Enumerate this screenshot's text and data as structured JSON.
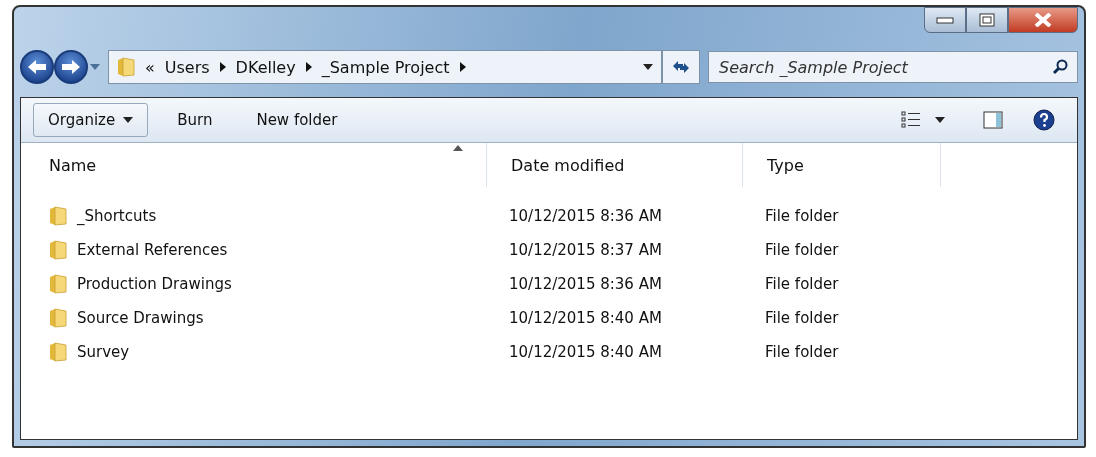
{
  "address_bar": {
    "overflow": "«",
    "crumbs": [
      "Users",
      "DKelley",
      "_Sample Project"
    ]
  },
  "search": {
    "placeholder": "Search _Sample Project"
  },
  "toolbar": {
    "buttons": [
      "Organize",
      "Burn",
      "New folder"
    ]
  },
  "table": {
    "columns": [
      "Name",
      "Date modified",
      "Type"
    ],
    "rows": [
      {
        "name": "_Shortcuts",
        "date": "10/12/2015 8:36 AM",
        "type": "File folder"
      },
      {
        "name": "External References",
        "date": "10/12/2015 8:37 AM",
        "type": "File folder"
      },
      {
        "name": "Production Drawings",
        "date": "10/12/2015 8:36 AM",
        "type": "File folder"
      },
      {
        "name": "Source Drawings",
        "date": "10/12/2015 8:40 AM",
        "type": "File folder"
      },
      {
        "name": "Survey",
        "date": "10/12/2015 8:40 AM",
        "type": "File folder"
      }
    ]
  }
}
